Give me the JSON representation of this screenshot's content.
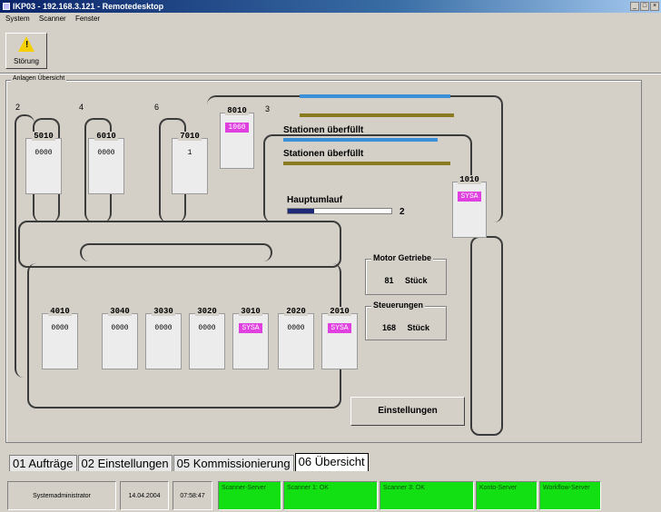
{
  "window": {
    "title": "IKP03 - 192.168.3.121 - Remotedesktop",
    "buttons": [
      "_",
      "□",
      "×"
    ]
  },
  "menu": [
    "System",
    "Scanner",
    "Fenster"
  ],
  "toolbar": {
    "alert_label": "Störung",
    "alert_icon": "warning-icon"
  },
  "plant": {
    "legend": "Anlagen Übersicht",
    "lane_numbers": [
      "2",
      "4",
      "6",
      "3"
    ],
    "top_stations": [
      {
        "id": "5010",
        "value": "0000",
        "highlight": false
      },
      {
        "id": "6010",
        "value": "0000",
        "highlight": false
      },
      {
        "id": "7010",
        "value": "1",
        "highlight": false
      },
      {
        "id": "8010",
        "value": "1060",
        "highlight": true
      }
    ],
    "side_station": {
      "id": "1010",
      "value": "SYSA",
      "highlight": true
    },
    "bottom_stations": [
      {
        "id": "4010",
        "value": "0000",
        "highlight": false
      },
      {
        "id": "3040",
        "value": "0000",
        "highlight": false
      },
      {
        "id": "3030",
        "value": "0000",
        "highlight": false
      },
      {
        "id": "3020",
        "value": "0000",
        "highlight": false
      },
      {
        "id": "3010",
        "value": "SYSA",
        "highlight": true
      },
      {
        "id": "2020",
        "value": "0000",
        "highlight": false
      },
      {
        "id": "2010",
        "value": "SYSA",
        "highlight": true
      }
    ],
    "overflow_1": "Stationen überfüllt",
    "overflow_2": "Stationen überfüllt",
    "main_loop_label": "Hauptumlauf",
    "main_loop_value": "2",
    "main_loop_level_pct": 25,
    "motor_group": {
      "legend": "Motor Getriebe",
      "count": "81",
      "unit": "Stück"
    },
    "control_group": {
      "legend": "Steuerungen",
      "count": "168",
      "unit": "Stück"
    },
    "settings_button": "Einstellungen",
    "colors": {
      "blue_bar": "#3a8fd8",
      "olive_bar": "#8a7a20",
      "highlight": "#e040e0"
    }
  },
  "tabs": [
    "01 Aufträge",
    "02 Einstellungen",
    "05 Kommissionierung",
    "06 Übersicht"
  ],
  "active_tab": "06 Übersicht",
  "status": {
    "user": "Systemadministrator",
    "date": "14.04.2004",
    "time": "07:58:47",
    "indicators": [
      "Scanner-Server",
      "Scanner 1: OK",
      "Scanner 3: OK",
      "Konto-Server",
      "Workflow-Server"
    ],
    "ok_color": "#12e012"
  }
}
